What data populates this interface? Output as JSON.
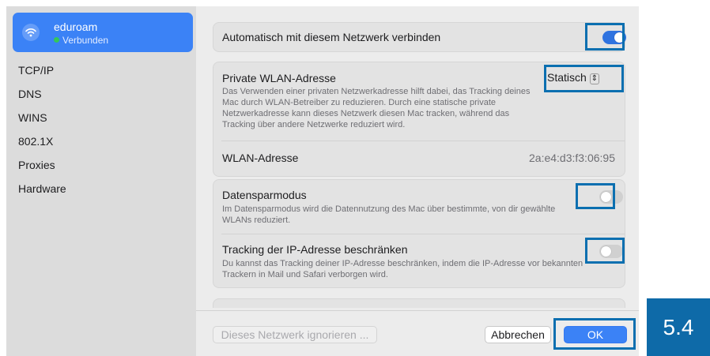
{
  "sidebar": {
    "network": {
      "name": "eduroam",
      "status": "Verbunden",
      "icon": "wifi-icon"
    },
    "items": [
      {
        "label": "TCP/IP"
      },
      {
        "label": "DNS"
      },
      {
        "label": "WINS"
      },
      {
        "label": "802.1X"
      },
      {
        "label": "Proxies"
      },
      {
        "label": "Hardware"
      }
    ]
  },
  "main": {
    "auto_join": {
      "label": "Automatisch mit diesem Netzwerk verbinden",
      "enabled": true
    },
    "private_address": {
      "label": "Private WLAN-Adresse",
      "value": "Statisch",
      "description": "Das Verwenden einer privaten Netzwerkadresse hilft dabei, das Tracking deines Mac durch WLAN-Betreiber zu reduzieren. Durch eine statische private Netzwerkadresse kann dieses Netzwerk diesen Mac tracken, während das Tracking über andere Netzwerke reduziert wird."
    },
    "wifi_address": {
      "label": "WLAN-Adresse",
      "value": "2a:e4:d3:f3:06:95"
    },
    "low_data": {
      "label": "Datensparmodus",
      "description": "Im Datensparmodus wird die Datennutzung des Mac über bestimmte, von dir gewählte WLANs reduziert.",
      "enabled": false
    },
    "limit_ip_tracking": {
      "label": "Tracking der IP-Adresse beschränken",
      "description": "Du kannst das Tracking deiner IP-Adresse beschränken, indem die IP-Adresse vor bekannten Trackern in Mail und Safari verborgen wird.",
      "enabled": false
    }
  },
  "footer": {
    "ignore_label": "Dieses Netzwerk ignorieren ...",
    "cancel_label": "Abbrechen",
    "ok_label": "OK"
  },
  "step_badge": "5.4",
  "colors": {
    "accent": "#3b82f6",
    "highlight": "#0b6fb0",
    "badge": "#0e6aa8"
  }
}
